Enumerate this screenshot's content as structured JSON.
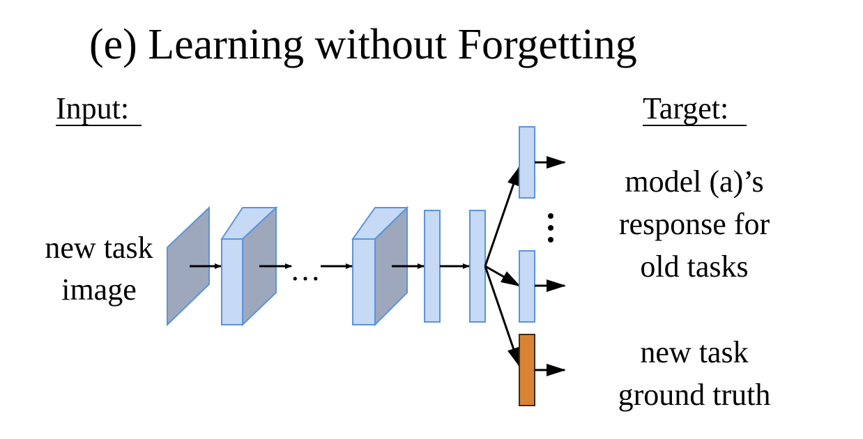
{
  "title": "(e) Learning without Forgetting",
  "input_header": "Input:",
  "target_header": "Target:",
  "input_label": [
    "new task",
    "image"
  ],
  "ellipsis": "…",
  "old_tasks_target": [
    "model (a)’s",
    "response for",
    "old tasks"
  ],
  "new_task_target": [
    "new task",
    "ground truth"
  ],
  "colors": {
    "layer_fill": "#c6d9f5",
    "layer_stroke": "#5b93db",
    "layer_dark": "#9ea8bc",
    "new_head_fill": "#d88434",
    "new_head_stroke": "#3f2a12",
    "arrow": "#000000"
  }
}
